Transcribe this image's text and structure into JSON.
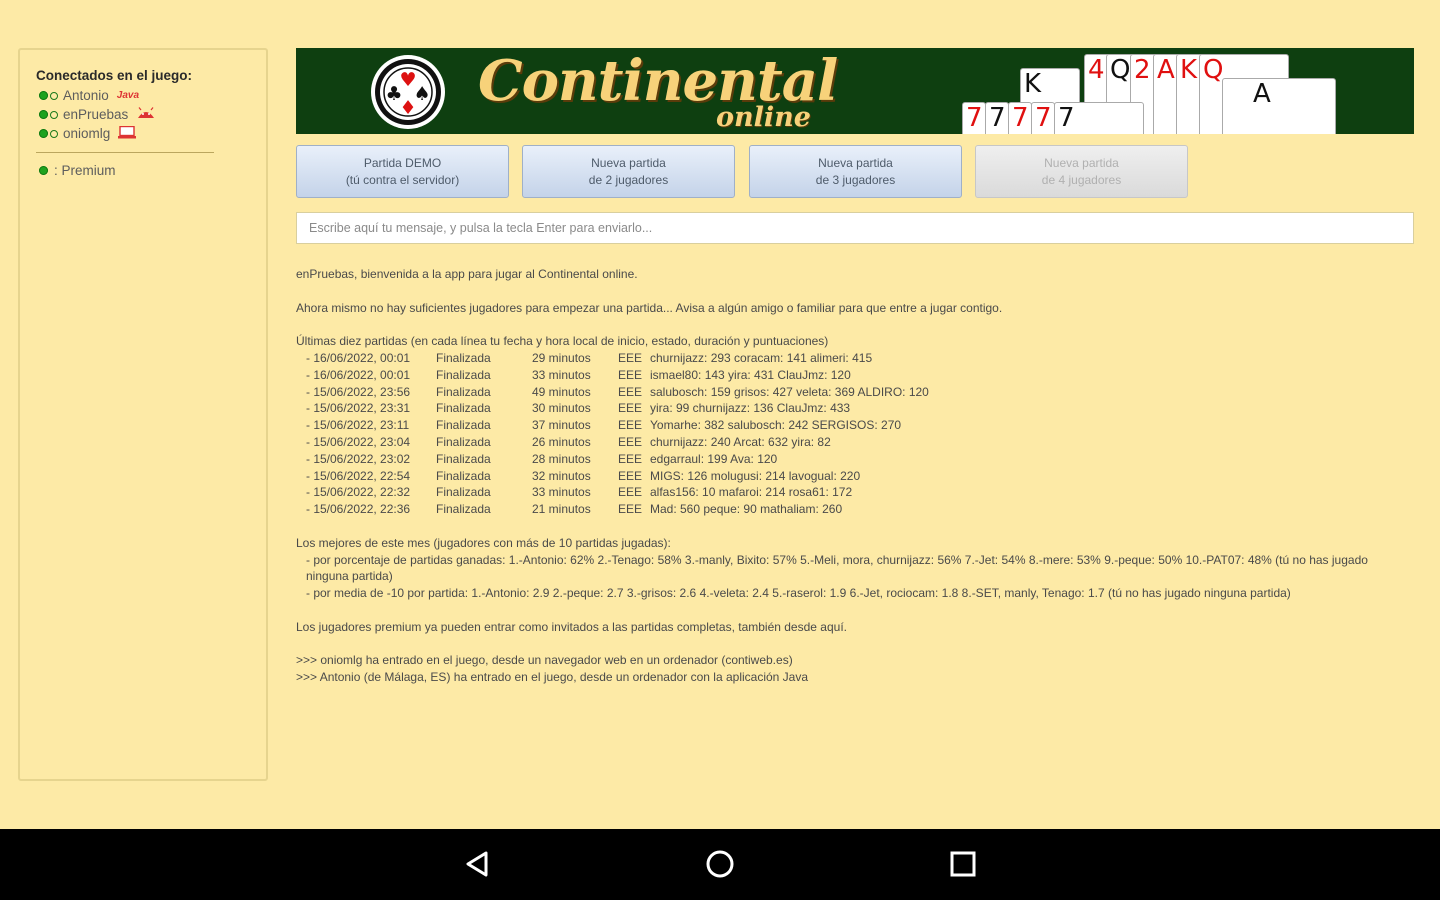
{
  "sidebar": {
    "title": "Conectados en el juego:",
    "users": [
      {
        "name": "Antonio",
        "client": "Java"
      },
      {
        "name": "enPruebas",
        "client": "android"
      },
      {
        "name": "oniomlg",
        "client": "computer"
      }
    ],
    "premium_label": ": Premium"
  },
  "banner": {
    "title": "Continental",
    "subtitle": "online",
    "cards": [
      "K",
      "4",
      "Q",
      "2",
      "A",
      "K",
      "Q",
      "A",
      "7",
      "7",
      "7",
      "7",
      "7"
    ]
  },
  "buttons": [
    {
      "line1": "Partida DEMO",
      "line2": "(tú contra el servidor)",
      "enabled": true
    },
    {
      "line1": "Nueva partida",
      "line2": "de 2 jugadores",
      "enabled": true
    },
    {
      "line1": "Nueva partida",
      "line2": "de 3 jugadores",
      "enabled": true
    },
    {
      "line1": "Nueva partida",
      "line2": "de 4 jugadores",
      "enabled": false
    }
  ],
  "input": {
    "placeholder": "Escribe aquí tu mensaje, y pulsa la tecla Enter para enviarlo...",
    "value": ""
  },
  "log": {
    "welcome": "enPruebas, bienvenida a la app para jugar al Continental online.",
    "notice": "Ahora mismo no hay suficientes jugadores para empezar una partida... Avisa a algún amigo o familiar para que entre a jugar contigo.",
    "games_header": "Últimas diez partidas (en cada línea tu fecha y hora local de inicio, estado, duración y puntuaciones)",
    "games": [
      {
        "date": "- 16/06/2022, 00:01",
        "status": "Finalizada",
        "duration": "29 minutos",
        "code": "EEE",
        "scores": "churnijazz: 293  coracam: 141  alimeri: 415"
      },
      {
        "date": "- 16/06/2022, 00:01",
        "status": "Finalizada",
        "duration": "33 minutos",
        "code": "EEE",
        "scores": "ismael80: 143  yira: 431  ClauJmz: 120"
      },
      {
        "date": "- 15/06/2022, 23:56",
        "status": "Finalizada",
        "duration": "49 minutos",
        "code": "EEE",
        "scores": "salubosch: 159  grisos: 427  veleta: 369  ALDIRO: 120"
      },
      {
        "date": "- 15/06/2022, 23:31",
        "status": "Finalizada",
        "duration": "30 minutos",
        "code": "EEE",
        "scores": "yira: 99  churnijazz: 136  ClauJmz: 433"
      },
      {
        "date": "- 15/06/2022, 23:11",
        "status": "Finalizada",
        "duration": "37 minutos",
        "code": "EEE",
        "scores": "Yomarhe: 382  salubosch: 242  SERGISOS: 270"
      },
      {
        "date": "- 15/06/2022, 23:04",
        "status": "Finalizada",
        "duration": "26 minutos",
        "code": "EEE",
        "scores": "churnijazz: 240  Arcat: 632  yira: 82"
      },
      {
        "date": "- 15/06/2022, 23:02",
        "status": "Finalizada",
        "duration": "28 minutos",
        "code": "EEE",
        "scores": "edgarraul: 199  Ava: 120"
      },
      {
        "date": "- 15/06/2022, 22:54",
        "status": "Finalizada",
        "duration": "32 minutos",
        "code": "EEE",
        "scores": "MIGS: 126  molugusi: 214  lavogual: 220"
      },
      {
        "date": "- 15/06/2022, 22:32",
        "status": "Finalizada",
        "duration": "33 minutos",
        "code": "EEE",
        "scores": "alfas156: 10  mafaroi: 214  rosa61: 172"
      },
      {
        "date": "- 15/06/2022, 22:36",
        "status": "Finalizada",
        "duration": "21 minutos",
        "code": "EEE",
        "scores": "Mad: 560  peque: 90  mathaliam: 260"
      }
    ],
    "best_header": "Los mejores de este mes (jugadores con más de 10 partidas jugadas):",
    "best_pct": "- por porcentaje de partidas ganadas: 1.-Antonio: 62%   2.-Tenago: 58%   3.-manly, Bixito: 57%   5.-Meli, mora, churnijazz: 56%   7.-Jet: 54%   8.-mere: 53%   9.-peque: 50%   10.-PAT07: 48%   (tú no has jugado ninguna partida)",
    "best_avg": "- por media de -10 por partida: 1.-Antonio: 2.9   2.-peque: 2.7   3.-grisos: 2.6   4.-veleta: 2.4   5.-raserol: 1.9   6.-Jet, rociocam: 1.8   8.-SET, manly, Tenago: 1.7   (tú no has jugado ninguna partida)",
    "premium_note": "Los jugadores premium ya pueden entrar como invitados a las partidas completas, también desde aquí.",
    "events": [
      ">>> oniomlg ha entrado en el juego, desde un navegador web en un ordenador (contiweb.es)",
      ">>> Antonio (de Málaga, ES) ha entrado en el juego, desde un ordenador con la aplicación Java"
    ]
  },
  "colors": {
    "background": "#fdeaa6",
    "banner": "#0e3f10",
    "title_gold": "#f7d27a",
    "online_green": "#1fa21f"
  }
}
